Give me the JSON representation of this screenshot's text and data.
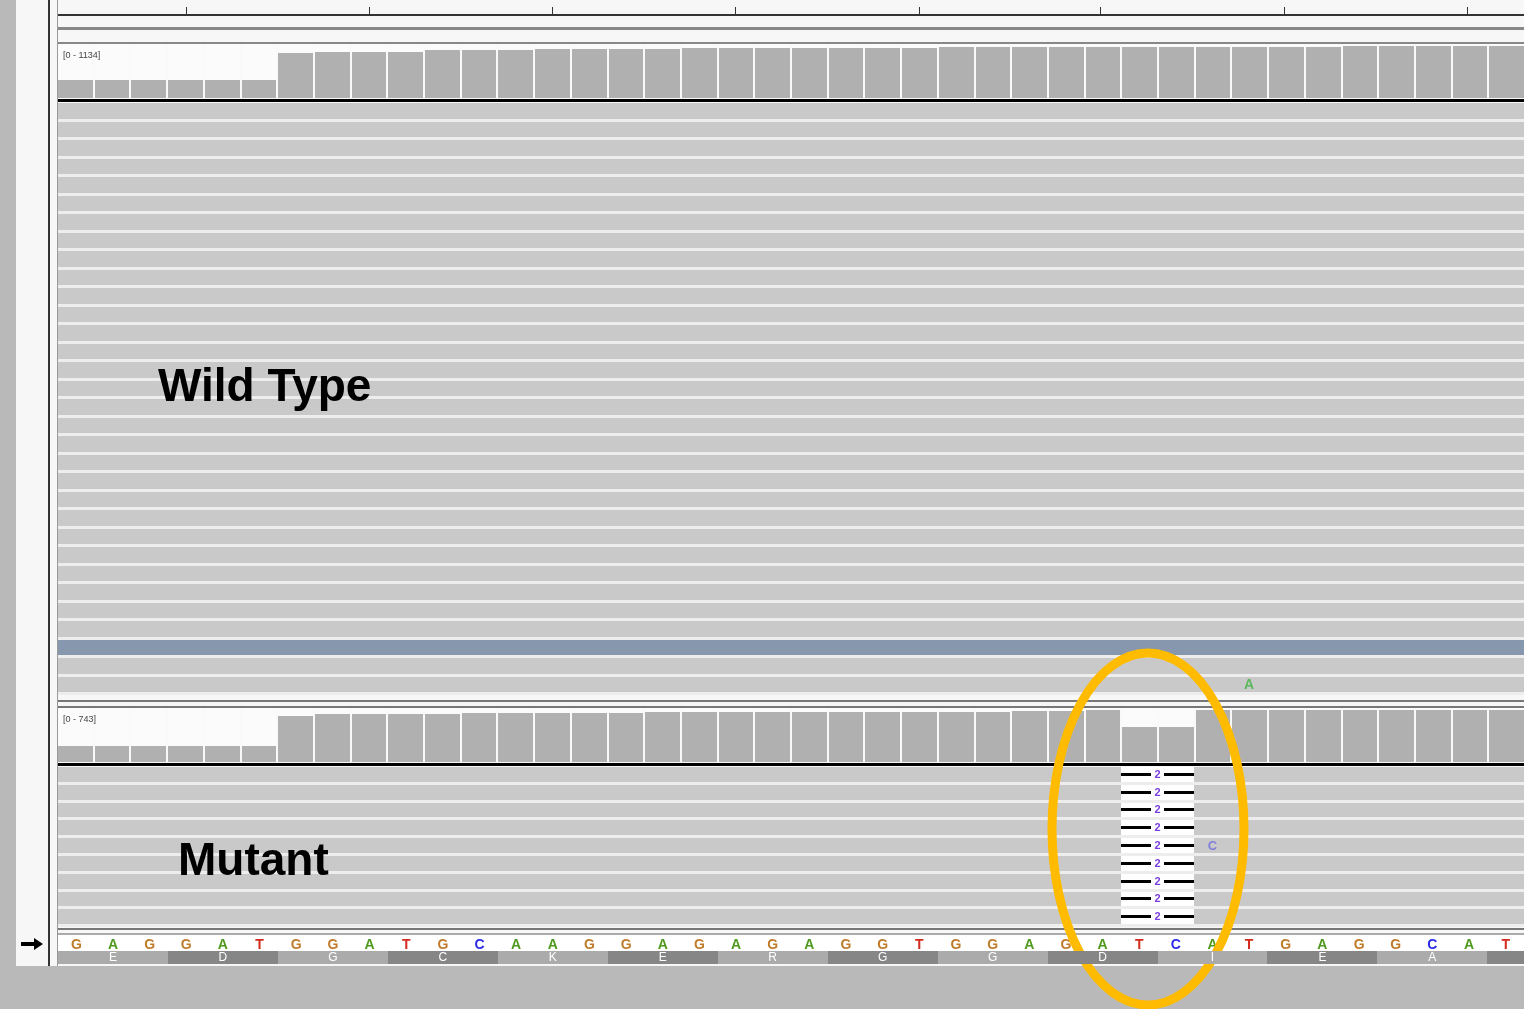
{
  "tracks": [
    {
      "kind": "wild",
      "range": "[0 - 1134]",
      "label": "Wild Type",
      "coverage": [
        {
          "level": 0.33
        },
        {
          "level": 0.33
        },
        {
          "level": 0.33
        },
        {
          "level": 0.33
        },
        {
          "level": 0.33
        },
        {
          "level": 0.33
        },
        {
          "level": 0.83
        },
        {
          "level": 0.86
        },
        {
          "level": 0.86
        },
        {
          "level": 0.86
        },
        {
          "level": 0.88
        },
        {
          "level": 0.88
        },
        {
          "level": 0.88
        },
        {
          "level": 0.9
        },
        {
          "level": 0.9
        },
        {
          "level": 0.9
        },
        {
          "level": 0.9
        },
        {
          "level": 0.92
        },
        {
          "level": 0.92
        },
        {
          "level": 0.92
        },
        {
          "level": 0.92
        },
        {
          "level": 0.92
        },
        {
          "level": 0.92
        },
        {
          "level": 0.92
        },
        {
          "level": 0.94
        },
        {
          "level": 0.94
        },
        {
          "level": 0.94
        },
        {
          "level": 0.94
        },
        {
          "level": 0.94
        },
        {
          "level": 0.94
        },
        {
          "level": 0.94
        },
        {
          "level": 0.94
        },
        {
          "level": 0.94
        },
        {
          "level": 0.94
        },
        {
          "level": 0.94
        },
        {
          "level": 0.96
        },
        {
          "level": 0.96
        },
        {
          "level": 0.96
        },
        {
          "level": 0.96
        },
        {
          "level": 0.96
        }
      ],
      "reads": [
        {
          "selected": false
        },
        {
          "selected": false
        },
        {
          "selected": false
        },
        {
          "selected": false
        },
        {
          "selected": false
        },
        {
          "selected": false
        },
        {
          "selected": false
        },
        {
          "selected": false
        },
        {
          "selected": false
        },
        {
          "selected": false
        },
        {
          "selected": false
        },
        {
          "selected": false
        },
        {
          "selected": false
        },
        {
          "selected": false
        },
        {
          "selected": false
        },
        {
          "selected": false
        },
        {
          "selected": false
        },
        {
          "selected": false
        },
        {
          "selected": false
        },
        {
          "selected": false
        },
        {
          "selected": false
        },
        {
          "selected": false
        },
        {
          "selected": false
        },
        {
          "selected": false
        },
        {
          "selected": false
        },
        {
          "selected": false
        },
        {
          "selected": false
        },
        {
          "selected": false
        },
        {
          "selected": false
        },
        {
          "selected": true
        },
        {
          "selected": false
        },
        {
          "selected": false,
          "mismatch": "A",
          "color": "#5cb85c"
        }
      ]
    },
    {
      "kind": "mutant",
      "range": "[0 - 743]",
      "label": "Mutant",
      "coverage": [
        {
          "level": 0.3
        },
        {
          "level": 0.3
        },
        {
          "level": 0.3
        },
        {
          "level": 0.3
        },
        {
          "level": 0.3
        },
        {
          "level": 0.3
        },
        {
          "level": 0.85
        },
        {
          "level": 0.88
        },
        {
          "level": 0.88
        },
        {
          "level": 0.88
        },
        {
          "level": 0.88
        },
        {
          "level": 0.9
        },
        {
          "level": 0.9
        },
        {
          "level": 0.9
        },
        {
          "level": 0.9
        },
        {
          "level": 0.9
        },
        {
          "level": 0.92
        },
        {
          "level": 0.92
        },
        {
          "level": 0.92
        },
        {
          "level": 0.92
        },
        {
          "level": 0.92
        },
        {
          "level": 0.92
        },
        {
          "level": 0.92
        },
        {
          "level": 0.92
        },
        {
          "level": 0.92
        },
        {
          "level": 0.92
        },
        {
          "level": 0.94
        },
        {
          "level": 0.94
        },
        {
          "level": 0.96
        },
        {
          "level": 0.64
        },
        {
          "level": 0.64
        },
        {
          "level": 0.96
        },
        {
          "level": 0.96
        },
        {
          "level": 0.96
        },
        {
          "level": 0.96
        },
        {
          "level": 0.96
        },
        {
          "level": 0.96
        },
        {
          "level": 0.96
        },
        {
          "level": 0.96
        },
        {
          "level": 0.96
        }
      ],
      "reads": [
        {
          "deletion_label": "2"
        },
        {
          "deletion_label": "2"
        },
        {
          "deletion_label": "2"
        },
        {
          "deletion_label": "2"
        },
        {
          "deletion_label": "2",
          "mismatch": "C",
          "color": "#8080d8"
        },
        {
          "deletion_label": "2"
        },
        {
          "deletion_label": "2"
        },
        {
          "deletion_label": "2"
        },
        {
          "deletion_label": "2"
        }
      ]
    }
  ],
  "sequence": [
    {
      "base": "G",
      "color": "#c07a28"
    },
    {
      "base": "A",
      "color": "#4f9a1e"
    },
    {
      "base": "G",
      "color": "#c07a28"
    },
    {
      "base": "G",
      "color": "#c07a28"
    },
    {
      "base": "A",
      "color": "#4f9a1e"
    },
    {
      "base": "T",
      "color": "#d42a1e"
    },
    {
      "base": "G",
      "color": "#c07a28"
    },
    {
      "base": "G",
      "color": "#c07a28"
    },
    {
      "base": "A",
      "color": "#4f9a1e"
    },
    {
      "base": "T",
      "color": "#d42a1e"
    },
    {
      "base": "G",
      "color": "#c07a28"
    },
    {
      "base": "C",
      "color": "#2a2ae8"
    },
    {
      "base": "A",
      "color": "#4f9a1e"
    },
    {
      "base": "A",
      "color": "#4f9a1e"
    },
    {
      "base": "G",
      "color": "#c07a28"
    },
    {
      "base": "G",
      "color": "#c07a28"
    },
    {
      "base": "A",
      "color": "#4f9a1e"
    },
    {
      "base": "G",
      "color": "#c07a28"
    },
    {
      "base": "A",
      "color": "#4f9a1e"
    },
    {
      "base": "G",
      "color": "#c07a28"
    },
    {
      "base": "A",
      "color": "#4f9a1e"
    },
    {
      "base": "G",
      "color": "#c07a28"
    },
    {
      "base": "G",
      "color": "#c07a28"
    },
    {
      "base": "T",
      "color": "#d42a1e"
    },
    {
      "base": "G",
      "color": "#c07a28"
    },
    {
      "base": "G",
      "color": "#c07a28"
    },
    {
      "base": "A",
      "color": "#4f9a1e"
    },
    {
      "base": "G",
      "color": "#c07a28"
    },
    {
      "base": "A",
      "color": "#4f9a1e"
    },
    {
      "base": "T",
      "color": "#d42a1e"
    },
    {
      "base": "C",
      "color": "#2a2ae8"
    },
    {
      "base": "A",
      "color": "#4f9a1e"
    },
    {
      "base": "T",
      "color": "#d42a1e"
    },
    {
      "base": "G",
      "color": "#c07a28"
    },
    {
      "base": "A",
      "color": "#4f9a1e"
    },
    {
      "base": "G",
      "color": "#c07a28"
    },
    {
      "base": "G",
      "color": "#c07a28"
    },
    {
      "base": "C",
      "color": "#2a2ae8"
    },
    {
      "base": "A",
      "color": "#4f9a1e"
    },
    {
      "base": "T",
      "color": "#d42a1e"
    }
  ],
  "amino_acids": [
    "E",
    "D",
    "G",
    "C",
    "K",
    "E",
    "R",
    "G",
    "G",
    "D",
    "I",
    "E",
    "A"
  ]
}
